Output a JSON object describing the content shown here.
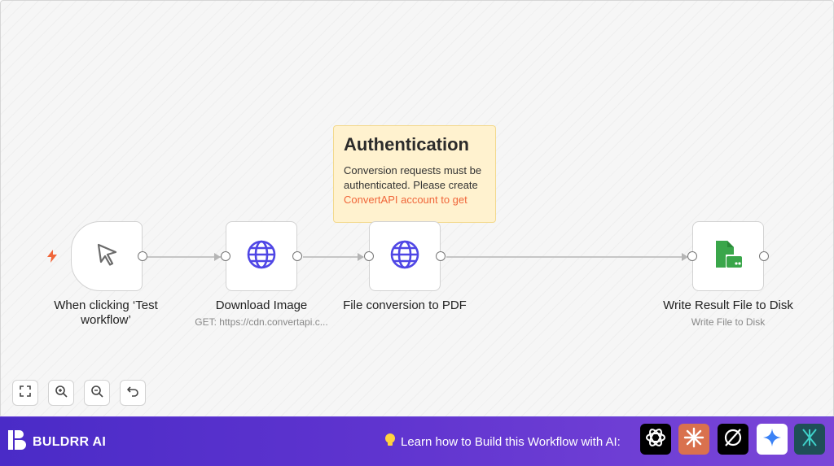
{
  "sticky": {
    "title": "Authentication",
    "body": "Conversion requests must be authenticated. Please create",
    "link": "ConvertAPI account to get"
  },
  "nodes": [
    {
      "title": "When clicking ‘Test workflow’",
      "subtitle": "",
      "icon": "cursor-icon"
    },
    {
      "title": "Download Image",
      "subtitle": "GET: https://cdn.convertapi.c...",
      "icon": "globe-icon"
    },
    {
      "title": "File conversion to PDF",
      "subtitle": "",
      "icon": "globe-icon"
    },
    {
      "title": "Write Result File to Disk",
      "subtitle": "Write File to Disk",
      "icon": "file-disk-icon"
    }
  ],
  "trigger_badge_icon": "lightning-icon",
  "controls": [
    {
      "icon": "fit-view-icon"
    },
    {
      "icon": "zoom-in-icon"
    },
    {
      "icon": "zoom-out-icon"
    },
    {
      "icon": "undo-icon"
    }
  ],
  "footer": {
    "brand": "BULDRR AI",
    "learn_text": "Learn how to Build this Workflow with AI:",
    "ai_tools": [
      "chatgpt-icon",
      "claude-icon",
      "perplexity-icon",
      "gemini-icon",
      "deepseek-icon"
    ]
  },
  "colors": {
    "accent_orange": "#f0663a",
    "globe_blue": "#4f46e5",
    "disk_green": "#3aa64a",
    "footer_purple": "#5f34cf",
    "sticky_yellow": "#fff2cf"
  }
}
